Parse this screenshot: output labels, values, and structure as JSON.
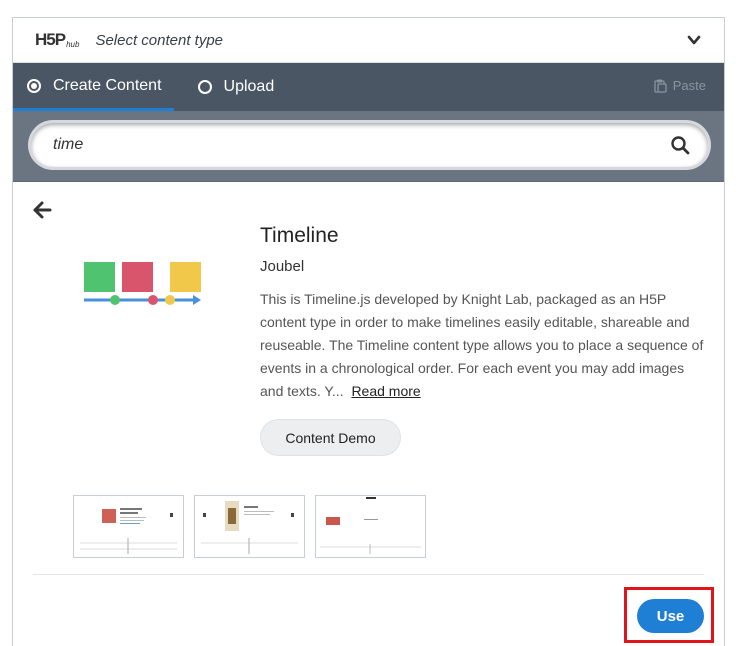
{
  "header": {
    "logo_text": "H5P",
    "logo_sub": "hub",
    "title": "Select content type"
  },
  "tabs": [
    {
      "label": "Create Content",
      "selected": true
    },
    {
      "label": "Upload",
      "selected": false
    }
  ],
  "paste_label": "Paste",
  "search": {
    "value": "time"
  },
  "content_type": {
    "title": "Timeline",
    "owner": "Joubel",
    "description": "This is Timeline.js developed by Knight Lab, packaged as an H5P content type in order to make timelines easily editable, shareable and reuseable. The Timeline content type allows you to place a sequence of events in a chronological order. For each event you may add images and texts. Y...",
    "read_more": "Read more",
    "demo_label": "Content Demo",
    "icon_colors": [
      "#4fc36f",
      "#d9556c",
      "#f2c84b",
      "#4a90d9"
    ]
  },
  "use_label": "Use",
  "colors": {
    "accent": "#1f7fd5",
    "tabbar": "#4a5663",
    "search_area": "#6b7581",
    "highlight": "#e0141b"
  }
}
